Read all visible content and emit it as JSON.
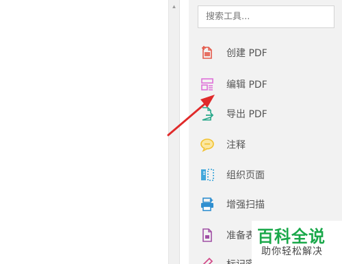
{
  "search": {
    "placeholder": "搜索工具..."
  },
  "tools": [
    {
      "label": "创建 PDF",
      "icon": "create-pdf-icon",
      "color": "#e45a4b"
    },
    {
      "label": "编辑 PDF",
      "icon": "edit-pdf-icon",
      "color": "#de6fd8"
    },
    {
      "label": "导出 PDF",
      "icon": "export-pdf-icon",
      "color": "#27a88a"
    },
    {
      "label": "注释",
      "icon": "comment-icon",
      "color": "#f2c12e"
    },
    {
      "label": "组织页面",
      "icon": "organize-pages-icon",
      "color": "#2f9fd8"
    },
    {
      "label": "增强扫描",
      "icon": "enhance-scan-icon",
      "color": "#2f8fd0"
    },
    {
      "label": "准备表",
      "icon": "prepare-form-icon",
      "color": "#a04fa5"
    },
    {
      "label": "标记密文",
      "icon": "redact-icon",
      "color": "#d24c8a"
    }
  ],
  "annotation": {
    "arrow_color": "#e02a2a"
  },
  "watermark": {
    "title": "百科全说",
    "subtitle": "助你轻松解决"
  }
}
